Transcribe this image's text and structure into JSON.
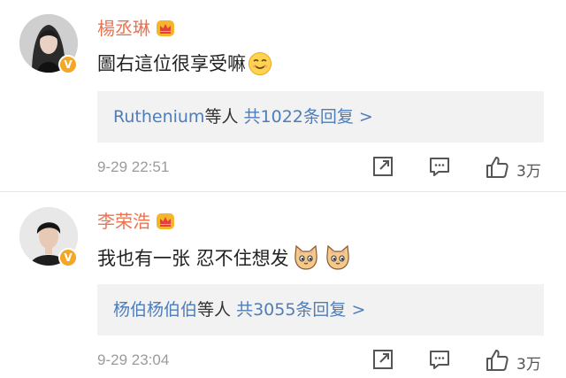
{
  "comments": [
    {
      "username": "楊丞琳",
      "text": "圖右這位很享受嘛",
      "reply_users": "Ruthenium",
      "reply_suffix": "等人",
      "reply_count": "共1022条回复 >",
      "time": "9-29 22:51",
      "likes": "3万",
      "badge": "V",
      "icons": [
        "crown-icon",
        "smile-emoji-icon",
        "share-icon",
        "comment-icon",
        "thumbs-up-icon"
      ]
    },
    {
      "username": "李荣浩",
      "text": "我也有一张 忍不住想发",
      "reply_users": "杨伯杨伯伯",
      "reply_suffix": "等人",
      "reply_count": "共3055条回复 >",
      "time": "9-29 23:04",
      "likes": "3万",
      "badge": "V",
      "icons": [
        "crown-icon",
        "cat-emoji-icon",
        "cat-emoji-icon",
        "share-icon",
        "comment-icon",
        "thumbs-up-icon"
      ]
    }
  ],
  "colors": {
    "username": "#eb7350",
    "link": "#4f7db8",
    "meta": "#9b9b9b",
    "reply_bg": "#f2f2f2",
    "badge": "#f5a623"
  }
}
